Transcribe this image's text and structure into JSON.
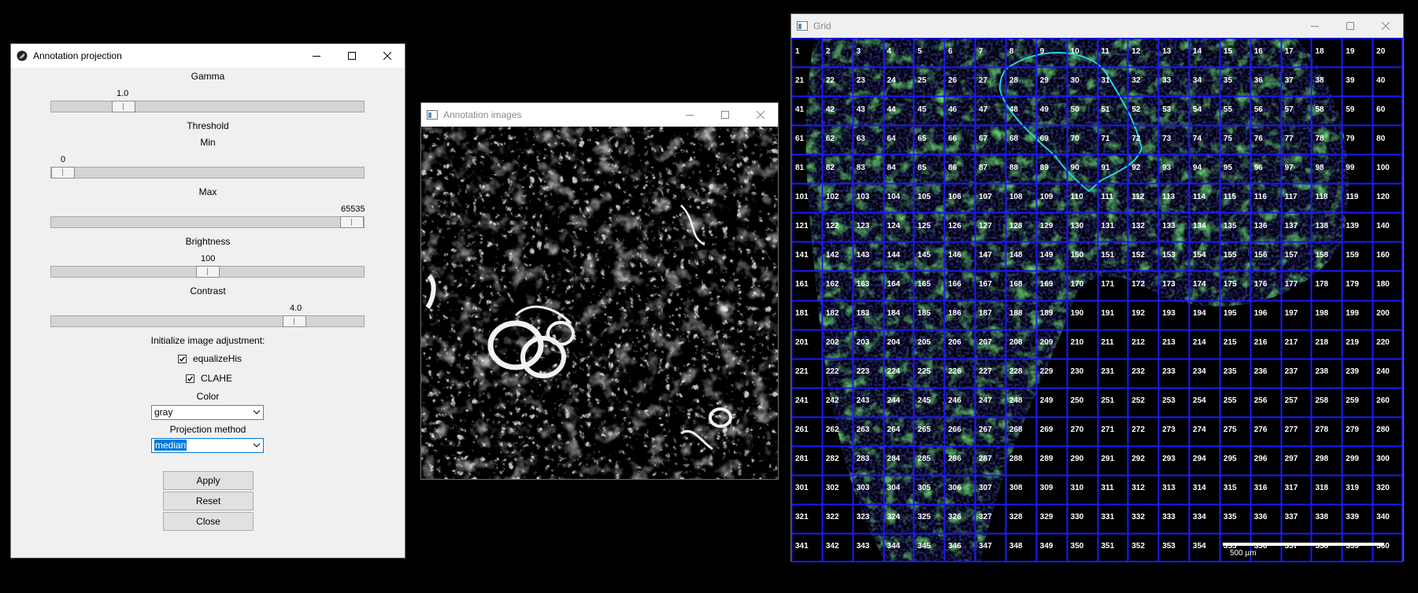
{
  "projection_window": {
    "title": "Annotation projection",
    "gamma_label": "Gamma",
    "gamma_value": "1.0",
    "gamma_position": 0.21,
    "threshold_label": "Threshold",
    "min_label": "Min",
    "min_value": "0",
    "min_position": 0.0,
    "max_label": "Max",
    "max_value": "65535",
    "max_position": 1.0,
    "brightness_label": "Brightness",
    "brightness_value": "100",
    "brightness_position": 0.5,
    "contrast_label": "Contrast",
    "contrast_value": "4.0",
    "contrast_position": 0.8,
    "init_label": "Initialize image adjustment:",
    "equalize_label": "equalizeHis",
    "equalize_checked": true,
    "clahe_label": "CLAHE",
    "clahe_checked": true,
    "color_label": "Color",
    "color_value": "gray",
    "projection_label": "Projection method",
    "projection_value": "median",
    "apply_label": "Apply",
    "reset_label": "Reset",
    "close_label": "Close"
  },
  "images_window": {
    "title": "Annotation images"
  },
  "grid_window": {
    "title": "Grid",
    "columns": 20,
    "rows": 18,
    "cell_numbers": [
      "1",
      "2",
      "3",
      "4",
      "5",
      "6",
      "7",
      "8",
      "9",
      "10",
      "11",
      "12",
      "13",
      "14",
      "15",
      "16",
      "17",
      "18",
      "19",
      "20",
      "21",
      "22",
      "23",
      "24",
      "25",
      "26",
      "27",
      "28",
      "29",
      "30",
      "31",
      "32",
      "33",
      "34",
      "35",
      "36",
      "37",
      "38",
      "39",
      "40",
      "41",
      "42",
      "43",
      "44",
      "45",
      "46",
      "47",
      "48",
      "49",
      "50",
      "51",
      "52",
      "53",
      "54",
      "55",
      "56",
      "57",
      "58",
      "59",
      "60",
      "61",
      "62",
      "63",
      "64",
      "65",
      "66",
      "67",
      "68",
      "69",
      "70",
      "71",
      "72",
      "73",
      "74",
      "75",
      "76",
      "77",
      "78",
      "79",
      "80",
      "81",
      "82",
      "83",
      "84",
      "85",
      "86",
      "87",
      "88",
      "89",
      "90",
      "91",
      "92",
      "93",
      "94",
      "95",
      "96",
      "97",
      "98",
      "99",
      "100",
      "101",
      "102",
      "103",
      "104",
      "105",
      "106",
      "107",
      "108",
      "109",
      "110",
      "111",
      "112",
      "113",
      "114",
      "115",
      "116",
      "117",
      "118",
      "119",
      "120",
      "121",
      "122",
      "123",
      "124",
      "125",
      "126",
      "127",
      "128",
      "129",
      "130",
      "131",
      "132",
      "133",
      "134",
      "135",
      "136",
      "137",
      "138",
      "139",
      "140",
      "141",
      "142",
      "143",
      "144",
      "145",
      "146",
      "147",
      "148",
      "149",
      "150",
      "151",
      "152",
      "153",
      "154",
      "155",
      "156",
      "157",
      "158",
      "159",
      "160",
      "161",
      "162",
      "163",
      "164",
      "165",
      "166",
      "167",
      "168",
      "169",
      "170",
      "171",
      "172",
      "173",
      "174",
      "175",
      "176",
      "177",
      "178",
      "179",
      "180",
      "181",
      "182",
      "183",
      "184",
      "185",
      "186",
      "187",
      "188",
      "189",
      "190",
      "191",
      "192",
      "193",
      "194",
      "195",
      "196",
      "197",
      "198",
      "199",
      "200",
      "201",
      "202",
      "203",
      "204",
      "205",
      "206",
      "207",
      "208",
      "209",
      "210",
      "211",
      "212",
      "213",
      "214",
      "215",
      "216",
      "217",
      "218",
      "219",
      "220",
      "221",
      "222",
      "223",
      "224",
      "225",
      "226",
      "227",
      "228",
      "229",
      "230",
      "231",
      "232",
      "233",
      "234",
      "235",
      "236",
      "237",
      "238",
      "239",
      "240",
      "241",
      "242",
      "243",
      "244",
      "245",
      "246",
      "247",
      "248",
      "249",
      "250",
      "251",
      "252",
      "253",
      "254",
      "255",
      "256",
      "257",
      "258",
      "259",
      "260",
      "261",
      "262",
      "263",
      "264",
      "265",
      "266",
      "267",
      "268",
      "269",
      "270",
      "271",
      "272",
      "273",
      "274",
      "275",
      "276",
      "277",
      "278",
      "279",
      "280",
      "281",
      "282",
      "283",
      "284",
      "285",
      "286",
      "287",
      "288",
      "289",
      "290",
      "291",
      "292",
      "293",
      "294",
      "295",
      "296",
      "297",
      "298",
      "299",
      "300",
      "301",
      "302",
      "303",
      "304",
      "305",
      "306",
      "307",
      "308",
      "309",
      "310",
      "311",
      "312",
      "313",
      "314",
      "315",
      "316",
      "317",
      "318",
      "319",
      "320",
      "321",
      "322",
      "323",
      "324",
      "325",
      "326",
      "327",
      "328",
      "329",
      "330",
      "331",
      "332",
      "333",
      "334",
      "335",
      "336",
      "337",
      "338",
      "339",
      "340",
      "341",
      "342",
      "343",
      "344",
      "345",
      "346",
      "347",
      "348",
      "349",
      "350",
      "351",
      "352",
      "353",
      "354",
      "355",
      "356",
      "357",
      "358",
      "359",
      "360"
    ],
    "scale_label": "500 µm",
    "grid_line_color": "#1a1aff",
    "outline_color": "#27d3e0",
    "tissue_color": "#2f9e2f"
  },
  "colors": {
    "desktop": "#000000",
    "window_bg": "#f0f0f0",
    "selection": "#0078d7"
  }
}
